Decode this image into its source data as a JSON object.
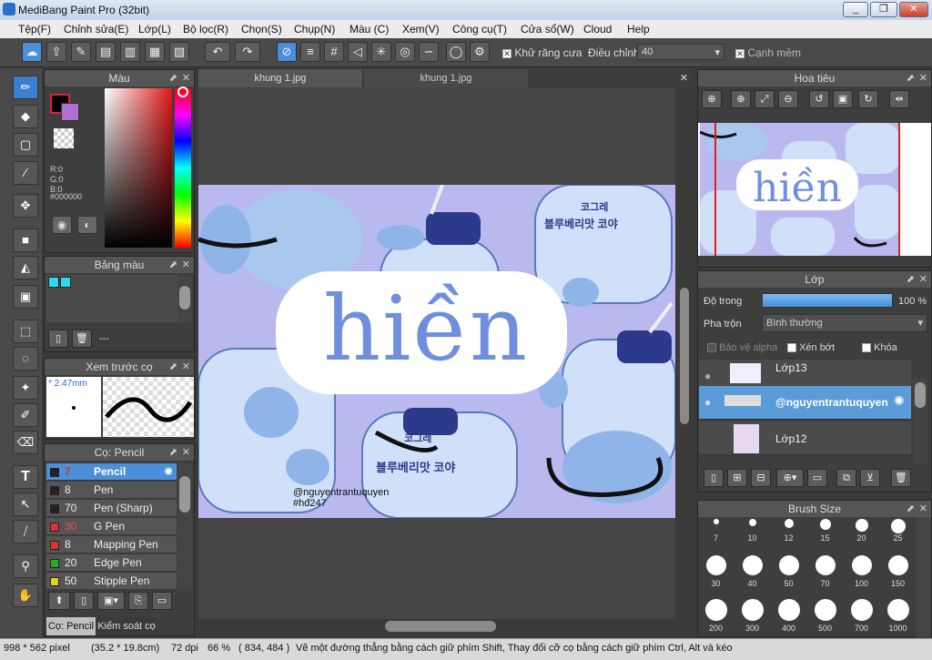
{
  "window": {
    "title": "MediBang Paint Pro (32bit)",
    "min": "_",
    "max": "❐",
    "close": "✕"
  },
  "menu": [
    "Tệp(F)",
    "Chỉnh sửa(E)",
    "Lớp(L)",
    "Bộ lọc(R)",
    "Chọn(S)",
    "Chụp(N)",
    "Màu (C)",
    "Xem(V)",
    "Công cụ(T)",
    "Cửa sổ(W)",
    "Cloud",
    "Help"
  ],
  "toolbar": {
    "antialias_label": "Khử răng cưa",
    "adjust_label": "Điều chỉnh",
    "adjust_value": "40",
    "smooth_label": "Cạnh mềm"
  },
  "tabs": [
    "khung 1.jpg",
    "khung 1.jpg"
  ],
  "color_panel": {
    "title": "Màu",
    "r": "R:0",
    "g": "G:0",
    "b": "B:0",
    "hex": "#000000"
  },
  "palette_panel": {
    "title": "Bảng màu",
    "value": "---"
  },
  "preview_panel": {
    "title": "Xem trước cọ",
    "size": "2.47mm"
  },
  "brush_panel": {
    "title": "Cọ: Pencil",
    "brushes": [
      {
        "size": "7",
        "name": "Pencil",
        "color": "#222222"
      },
      {
        "size": "8",
        "name": "Pen",
        "color": "#222222"
      },
      {
        "size": "70",
        "name": "Pen (Sharp)",
        "color": "#222222"
      },
      {
        "size": "30",
        "name": "G Pen",
        "color": "#e03030"
      },
      {
        "size": "8",
        "name": "Mapping Pen",
        "color": "#e03030"
      },
      {
        "size": "20",
        "name": "Edge Pen",
        "color": "#20b020"
      },
      {
        "size": "50",
        "name": "Stipple Pen",
        "color": "#e0d020"
      }
    ],
    "bottom_tabs": [
      "Cọ: Pencil",
      "Kiểm soát cọ"
    ]
  },
  "canvas": {
    "watermark_user": "@nguyentrantuquyen",
    "watermark_tag": "#hđ247",
    "title_text": "hiền",
    "cup_text": "블루베리맛 코야",
    "cup_brand": "코그레"
  },
  "navigator": {
    "title": "Hoa tiêu"
  },
  "layer_panel": {
    "title": "Lớp",
    "opacity_label": "Độ trong",
    "opacity_value": "100 %",
    "blend_label": "Pha trộn",
    "blend_value": "Bình thường",
    "protect_alpha": "Bảo vệ alpha",
    "clip": "Xén bớt",
    "lock": "Khóa",
    "layers": [
      {
        "name": "Lớp13"
      },
      {
        "name": "@nguyentrantuquyen"
      },
      {
        "name": "Lớp12"
      }
    ]
  },
  "brushsize_panel": {
    "title": "Brush Size",
    "sizes": [
      "7",
      "10",
      "12",
      "15",
      "20",
      "25",
      "30",
      "40",
      "50",
      "70",
      "100",
      "150",
      "200",
      "300",
      "400",
      "500",
      "700",
      "1000"
    ]
  },
  "status": {
    "dims": "998 * 562 pixel",
    "mm": "(35.2 * 19.8cm)",
    "dpi": "72 dpi",
    "zoom": "66 %",
    "coords": "( 834, 484 )",
    "hint": "Vẽ một đường thẳng bằng cách giữ phím Shift, Thay đổi cỡ cọ bằng cách giữ phím Ctrl, Alt và kéo"
  },
  "colors": {
    "accent": "#4a8fd8",
    "canvas_bg": "#b9b9f0"
  }
}
